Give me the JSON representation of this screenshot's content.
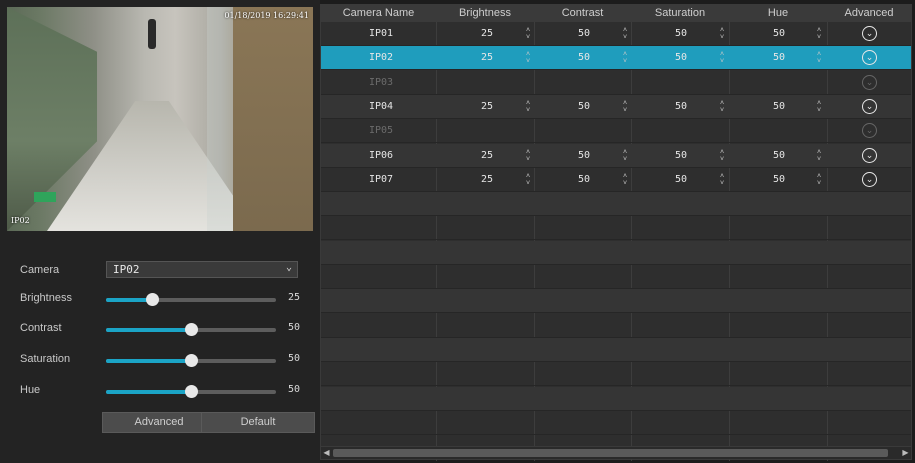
{
  "preview": {
    "timestamp": "01/18/2019 16:29:41",
    "camera_label": "IP02"
  },
  "settings": {
    "camera_label": "Camera",
    "camera_value": "IP02",
    "sliders": [
      {
        "label": "Brightness",
        "value": "25",
        "level": 0.25
      },
      {
        "label": "Contrast",
        "value": "50",
        "level": 0.5
      },
      {
        "label": "Saturation",
        "value": "50",
        "level": 0.5
      },
      {
        "label": "Hue",
        "value": "50",
        "level": 0.5
      }
    ],
    "advanced_label": "Advanced",
    "default_label": "Default"
  },
  "table": {
    "headers": [
      "Camera Name",
      "Brightness",
      "Contrast",
      "Saturation",
      "Hue",
      "Advanced"
    ],
    "rows": [
      {
        "name": "IP01",
        "brightness": "25",
        "contrast": "50",
        "saturation": "50",
        "hue": "50",
        "state": "normal"
      },
      {
        "name": "IP02",
        "brightness": "25",
        "contrast": "50",
        "saturation": "50",
        "hue": "50",
        "state": "selected"
      },
      {
        "name": "IP03",
        "brightness": "",
        "contrast": "",
        "saturation": "",
        "hue": "",
        "state": "dim"
      },
      {
        "name": "IP04",
        "brightness": "25",
        "contrast": "50",
        "saturation": "50",
        "hue": "50",
        "state": "normal"
      },
      {
        "name": "IP05",
        "brightness": "",
        "contrast": "",
        "saturation": "",
        "hue": "",
        "state": "dim"
      },
      {
        "name": "IP06",
        "brightness": "25",
        "contrast": "50",
        "saturation": "50",
        "hue": "50",
        "state": "normal"
      },
      {
        "name": "IP07",
        "brightness": "25",
        "contrast": "50",
        "saturation": "50",
        "hue": "50",
        "state": "normal"
      }
    ],
    "empty_rows": 10
  },
  "colors": {
    "accent": "#1ba4c6",
    "selected_row": "#1f9dbd"
  },
  "icons": {
    "select": "chevron-down-icon",
    "spinner": "up-down-spinner-icon",
    "advanced": "circle-chevron-down-icon",
    "scroll_left": "arrow-left-icon",
    "scroll_right": "arrow-right-icon"
  }
}
